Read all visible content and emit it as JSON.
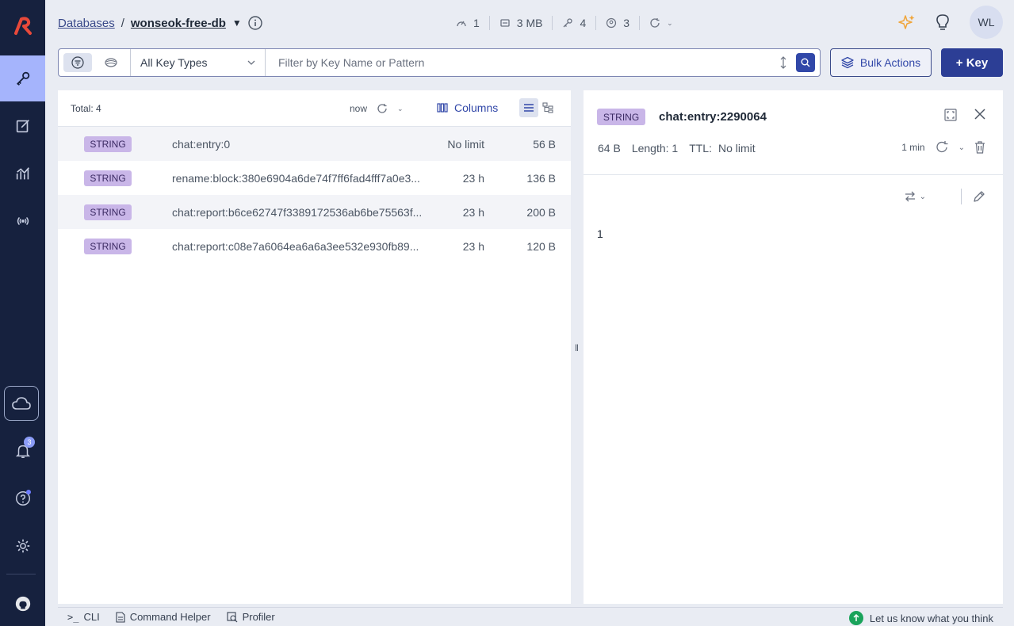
{
  "header": {
    "breadcrumb_root": "Databases",
    "breadcrumb_sep": "/",
    "database_name": "wonseok-free-db",
    "stats": {
      "cpu": "1",
      "memory": "3 MB",
      "keys": "4",
      "clients": "3"
    },
    "avatar_initials": "WL"
  },
  "nav": {
    "notification_count": "3"
  },
  "filter": {
    "key_types_label": "All Key Types",
    "search_placeholder": "Filter by Key Name or Pattern",
    "bulk_label": "Bulk Actions",
    "add_key_label": "+ Key"
  },
  "list": {
    "total_label": "Total: 4",
    "refresh_label": "now",
    "columns_label": "Columns",
    "rows": [
      {
        "type": "STRING",
        "name": "chat:entry:0",
        "ttl": "No limit",
        "size": "56 B"
      },
      {
        "type": "STRING",
        "name": "rename:block:380e6904a6de74f7ff6fad4fff7a0e3...",
        "ttl": "23 h",
        "size": "136 B"
      },
      {
        "type": "STRING",
        "name": "chat:report:b6ce62747f3389172536ab6be75563f...",
        "ttl": "23 h",
        "size": "200 B"
      },
      {
        "type": "STRING",
        "name": "chat:report:c08e7a6064ea6a6a3ee532e930fb89...",
        "ttl": "23 h",
        "size": "120 B"
      }
    ]
  },
  "detail": {
    "type": "STRING",
    "key_name": "chat:entry:2290064",
    "size": "64 B",
    "length_label": "Length: 1",
    "ttl_label": "TTL:",
    "ttl_value": "No limit",
    "refresh_label": "1 min",
    "value": "1"
  },
  "bottom": {
    "cli_label": "CLI",
    "helper_label": "Command Helper",
    "profiler_label": "Profiler",
    "feedback_label": "Let us know what you think"
  },
  "colors": {
    "nav_bg": "#16213e",
    "accent": "#3147a8",
    "tag_bg": "#c9b6e8",
    "active_nav": "#a5b4fc"
  }
}
